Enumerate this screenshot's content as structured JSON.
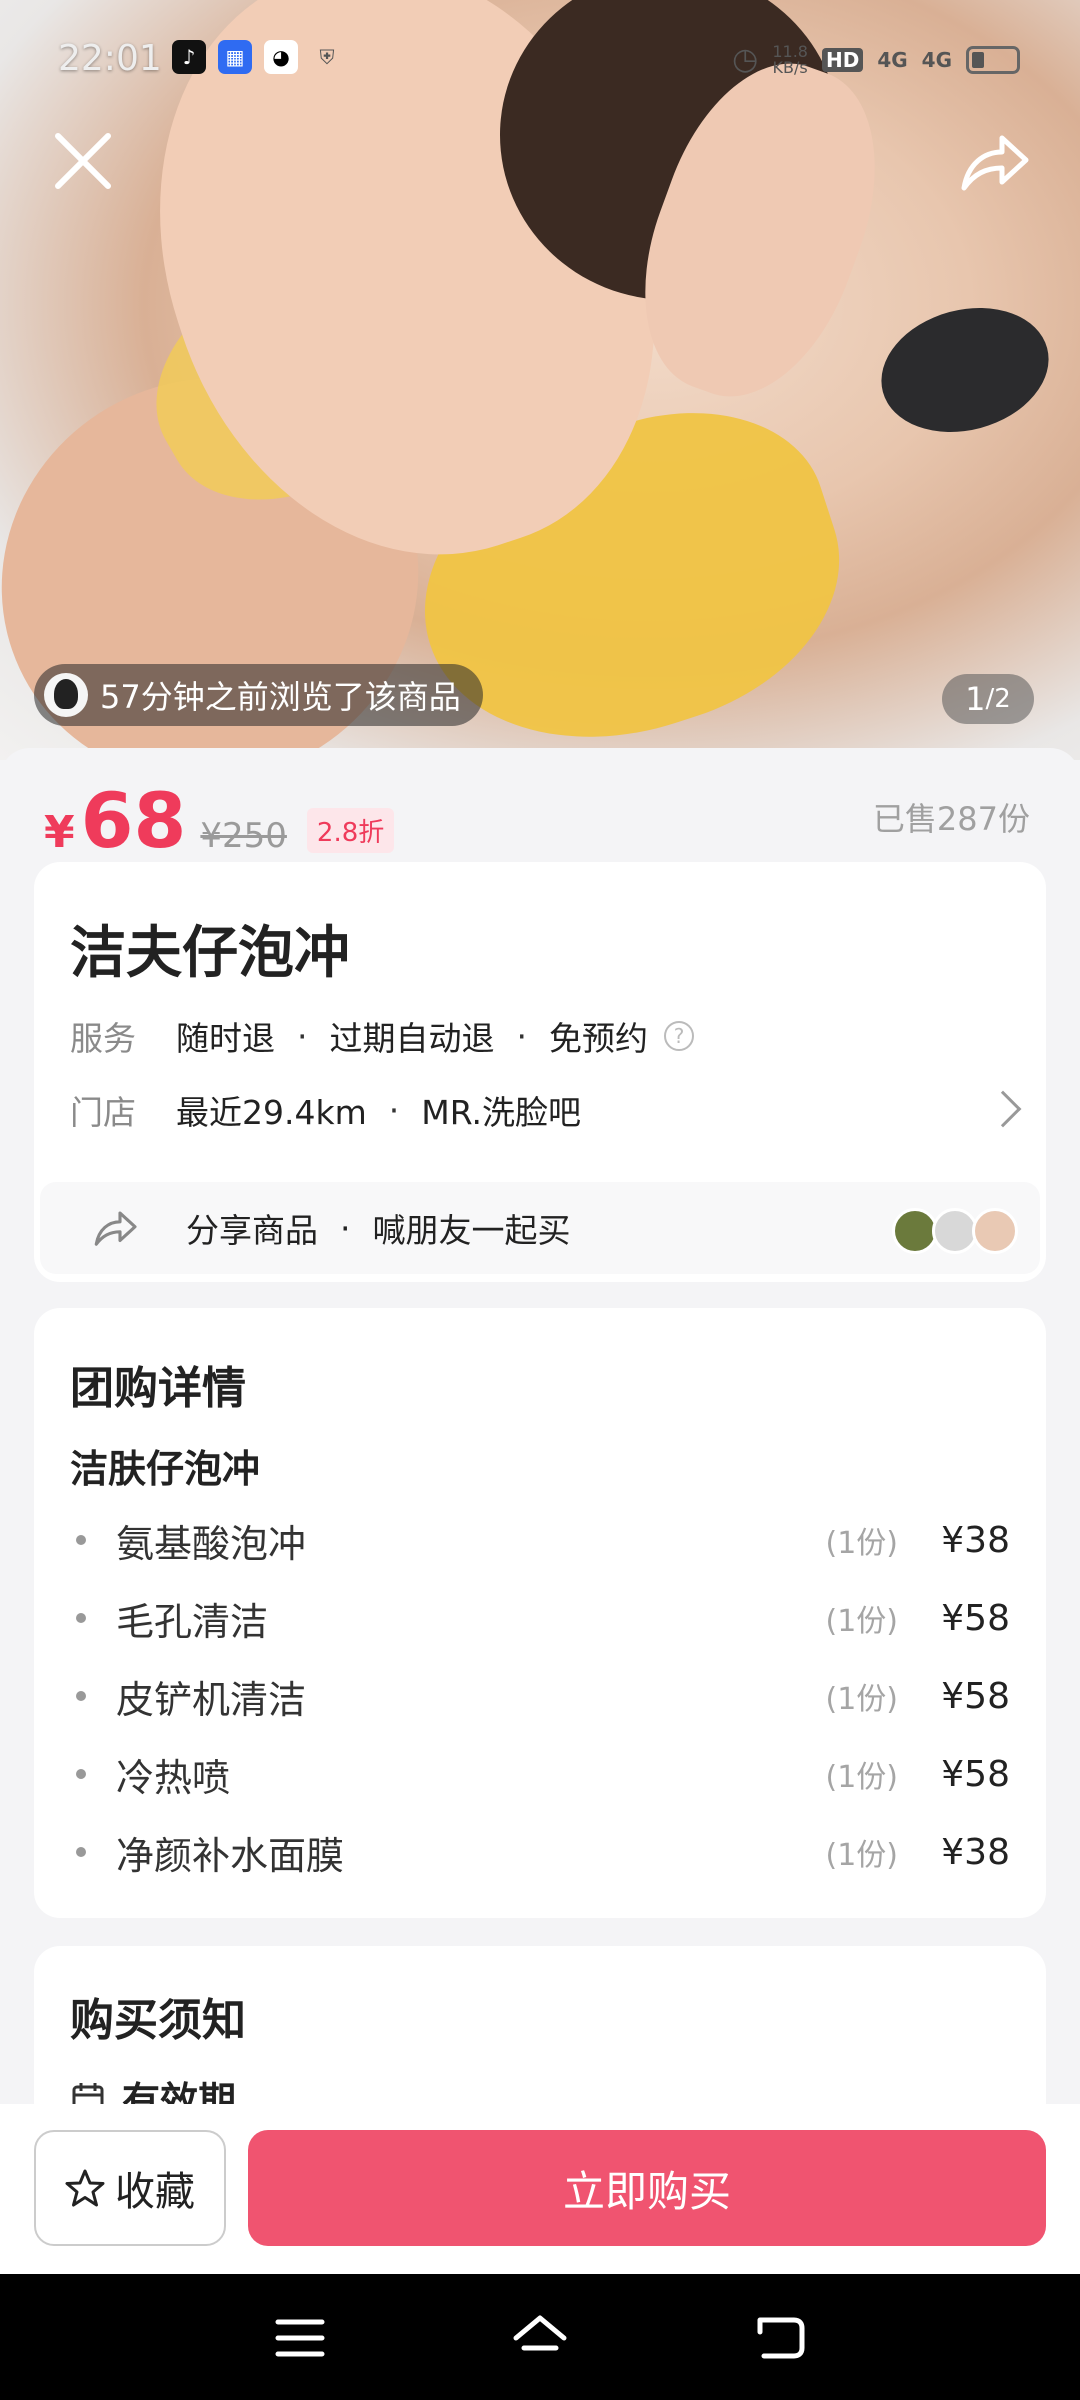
{
  "status_bar": {
    "time": "22:01",
    "net_speed": "11.8\nKB/s",
    "hd": "HD",
    "sig1": "4G",
    "sig2": "4G"
  },
  "hero": {
    "viewed_text": "57分钟之前浏览了该商品",
    "pager_current": "1",
    "pager_total": "/2"
  },
  "price": {
    "currency": "¥",
    "current": "68",
    "original": "¥250",
    "discount": "2.8折",
    "sold": "已售287份"
  },
  "product": {
    "title": "洁夫仔泡冲",
    "service_label": "服务",
    "services": [
      "随时退",
      "过期自动退",
      "免预约"
    ],
    "store_label": "门店",
    "store_distance": "最近29.4km",
    "store_name": "MR.洗脸吧",
    "share_label": "分享商品",
    "share_sub": "喊朋友一起买"
  },
  "details": {
    "heading": "团购详情",
    "package_name": "洁肤仔泡冲",
    "items": [
      {
        "name": "氨基酸泡冲",
        "qty": "(1份)",
        "price": "¥38"
      },
      {
        "name": "毛孔清洁",
        "qty": "(1份)",
        "price": "¥58"
      },
      {
        "name": "皮铲机清洁",
        "qty": "(1份)",
        "price": "¥58"
      },
      {
        "name": "冷热喷",
        "qty": "(1份)",
        "price": "¥58"
      },
      {
        "name": "净颜补水面膜",
        "qty": "(1份)",
        "price": "¥38"
      }
    ]
  },
  "notice": {
    "heading": "购买须知",
    "validity": "有效期"
  },
  "bottom_bar": {
    "favorite": "收藏",
    "buy": "立即购买"
  },
  "colors": {
    "accent": "#ef3b5b",
    "buy_button": "#f05470"
  }
}
